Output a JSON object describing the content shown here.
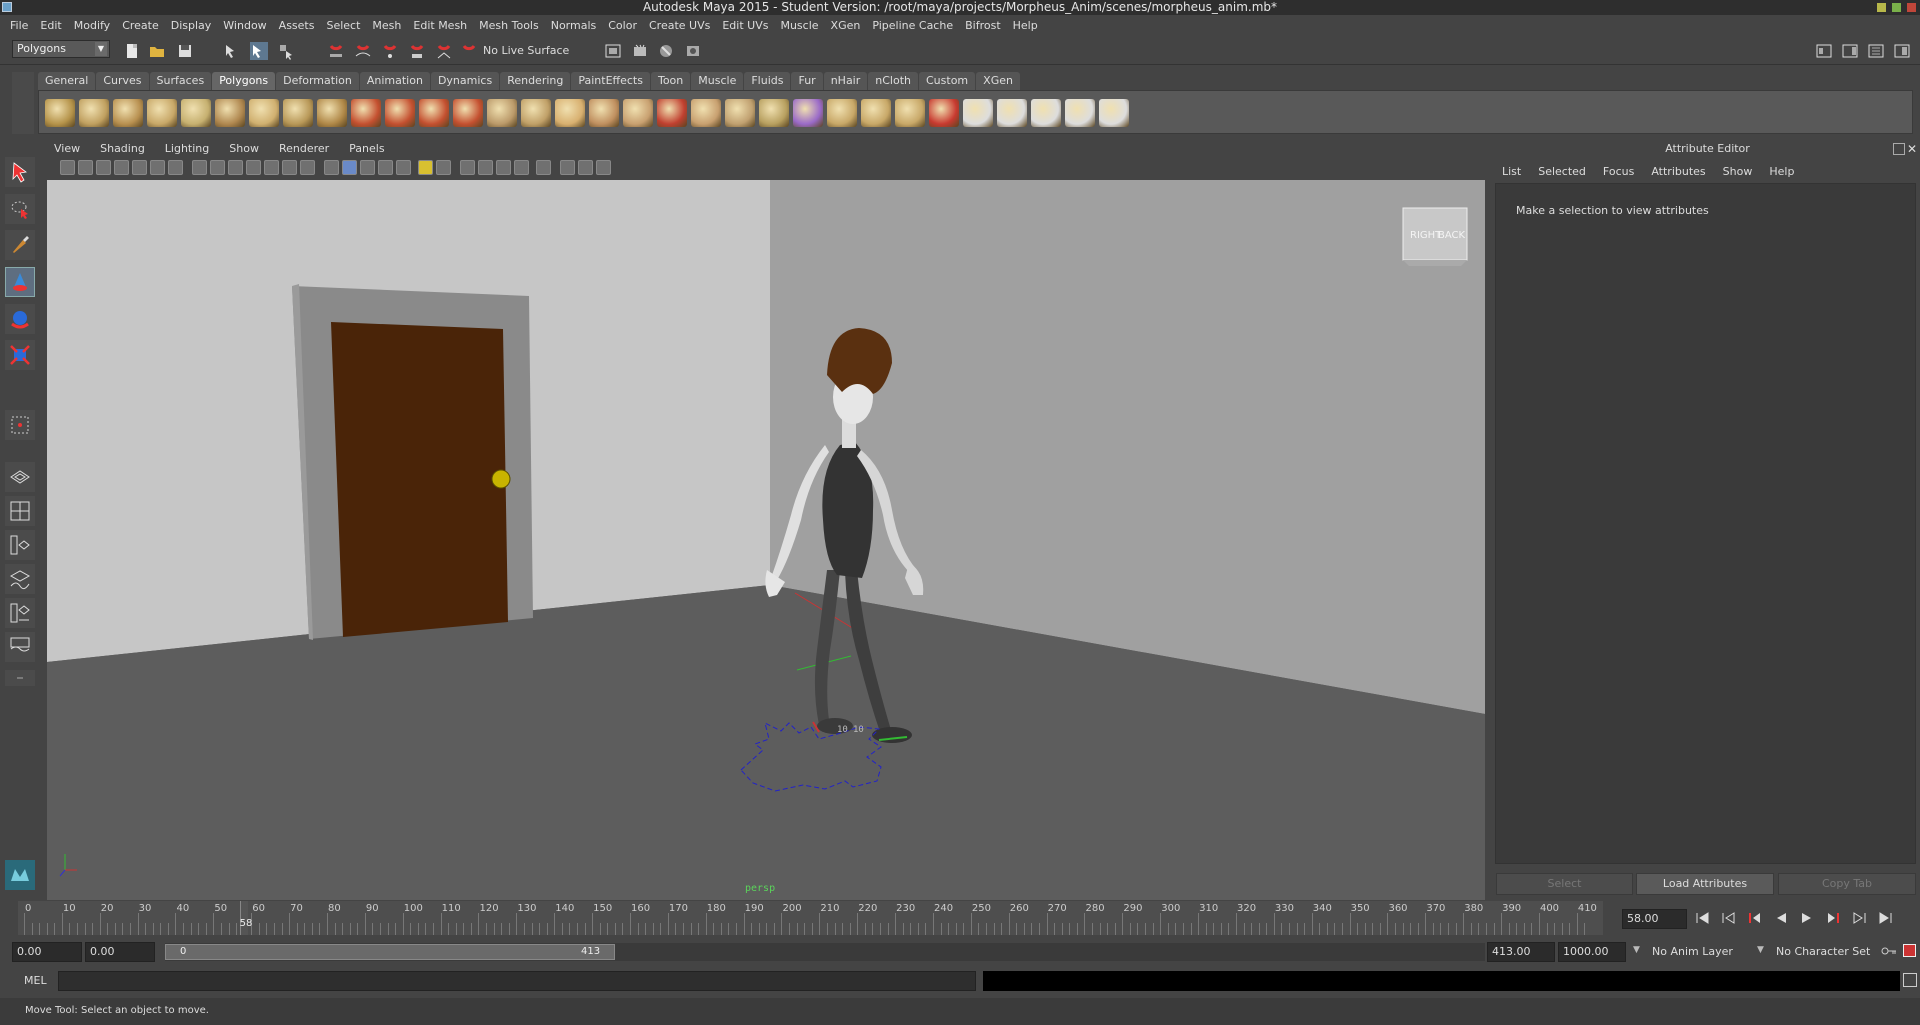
{
  "window": {
    "title": "Autodesk Maya 2015 - Student Version: /root/maya/projects/Morpheus_Anim/scenes/morpheus_anim.mb*"
  },
  "menubar": [
    "File",
    "Edit",
    "Modify",
    "Create",
    "Display",
    "Window",
    "Assets",
    "Select",
    "Mesh",
    "Edit Mesh",
    "Mesh Tools",
    "Normals",
    "Color",
    "Create UVs",
    "Edit UVs",
    "Muscle",
    "XGen",
    "Pipeline Cache",
    "Bifrost",
    "Help"
  ],
  "statusline": {
    "menuset": "Polygons",
    "live_surface": "No Live Surface"
  },
  "shelf_tabs": [
    "General",
    "Curves",
    "Surfaces",
    "Polygons",
    "Deformation",
    "Animation",
    "Dynamics",
    "Rendering",
    "PaintEffects",
    "Toon",
    "Muscle",
    "Fluids",
    "Fur",
    "nHair",
    "nCloth",
    "Custom",
    "XGen"
  ],
  "active_shelf": "Polygons",
  "viewport": {
    "menu": [
      "View",
      "Shading",
      "Lighting",
      "Show",
      "Renderer",
      "Panels"
    ],
    "camera": "persp",
    "viewcube": {
      "left": "RIGHT",
      "right": "BACK"
    }
  },
  "attribute_editor": {
    "title": "Attribute Editor",
    "menu": [
      "List",
      "Selected",
      "Focus",
      "Attributes",
      "Show",
      "Help"
    ],
    "message": "Make a selection to view attributes",
    "buttons": {
      "select": "Select",
      "load": "Load Attributes",
      "copy": "Copy Tab"
    }
  },
  "timeline": {
    "ticks": [
      "0",
      "10",
      "20",
      "30",
      "40",
      "50",
      "60",
      "70",
      "80",
      "90",
      "100",
      "110",
      "120",
      "130",
      "140",
      "150",
      "160",
      "170",
      "180",
      "190",
      "200",
      "210",
      "220",
      "230",
      "240",
      "250",
      "260",
      "270",
      "280",
      "290",
      "300",
      "310",
      "320",
      "330",
      "340",
      "350",
      "360",
      "370",
      "380",
      "390",
      "400",
      "410"
    ],
    "current_frame_marker": "58",
    "current_frame": "58.00"
  },
  "range": {
    "start_time": "0.00",
    "playback_start": "0.00",
    "slider_start": "0",
    "slider_end": "413",
    "playback_end": "413.00",
    "end_time": "1000.00",
    "anim_layer": "No Anim Layer",
    "character_set": "No Character Set"
  },
  "command_line": {
    "label": "MEL"
  },
  "help_line": "Move Tool: Select an object to move."
}
